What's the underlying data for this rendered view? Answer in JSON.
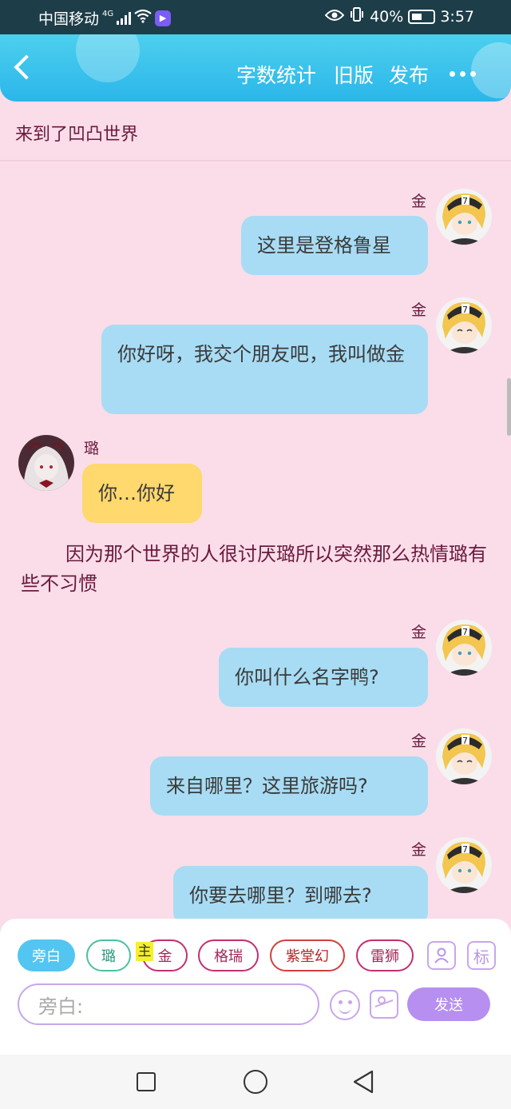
{
  "status_bar": {
    "carrier": "中国移动",
    "network": "4G",
    "battery": "40%",
    "time": "3:57"
  },
  "header": {
    "word_count": "字数统计",
    "old_version": "旧版",
    "publish": "发布"
  },
  "story_title": "来到了凹凸世界",
  "messages": [
    {
      "speaker": "金",
      "text": "这里是登格鲁星"
    },
    {
      "speaker": "金",
      "text": "你好呀，我交个朋友吧，我叫做金"
    },
    {
      "speaker": "璐",
      "text": "你…你好"
    },
    {
      "speaker": "金",
      "text": "你叫什么名字鸭?"
    },
    {
      "speaker": "金",
      "text": "来自哪里？这里旅游吗?"
    },
    {
      "speaker": "金",
      "text": "你要去哪里？到哪去?"
    }
  ],
  "narration": "因为那个世界的人很讨厌璐所以突然那么热情璐有些不习惯",
  "characters": {
    "narrator": "旁白",
    "lu": "璐",
    "main_tag": "主",
    "jin": "金",
    "gerui": "格瑞",
    "zitang": "紫堂幻",
    "leishi": "雷狮",
    "tag": "标"
  },
  "input": {
    "placeholder": "旁白:"
  },
  "send_label": "发送",
  "colors": {
    "background": "#fadde8",
    "header": "#2bb6ea",
    "blue_bubble": "#a8dcf4",
    "yellow_bubble": "#ffd86e",
    "accent": "#b78ff0"
  }
}
